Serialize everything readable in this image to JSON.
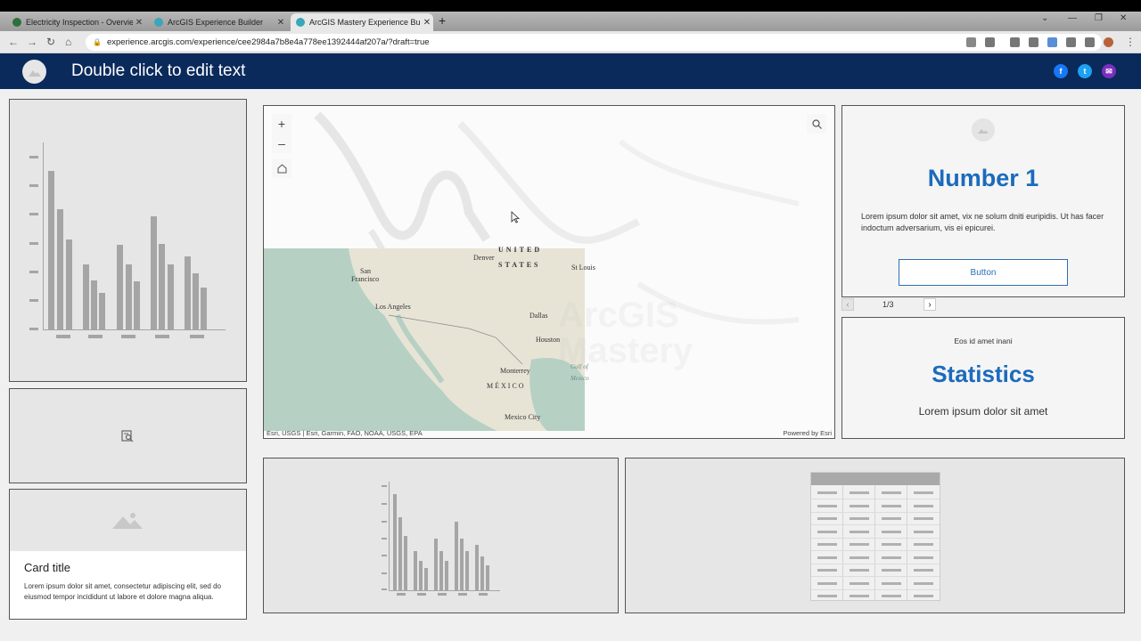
{
  "browser": {
    "tabs": [
      {
        "title": "Electricity Inspection - Overview",
        "active": false
      },
      {
        "title": "ArcGIS Experience Builder",
        "active": false
      },
      {
        "title": "ArcGIS Mastery Experience Builde",
        "active": true
      }
    ],
    "new_tab": "+",
    "url": "experience.arcgis.com/experience/cee2984a7b8e4a778ee1392444af207a/?draft=true"
  },
  "header": {
    "title": "Double click to edit text",
    "social": [
      {
        "name": "facebook",
        "glyph": "f",
        "color": "#1877f2"
      },
      {
        "name": "twitter",
        "glyph": "t",
        "color": "#1da1f2"
      },
      {
        "name": "email",
        "glyph": "✉",
        "color": "#7b2fbf"
      }
    ]
  },
  "map": {
    "zoom_in": "+",
    "zoom_out": "–",
    "labels": [
      "UNITED",
      "STATES",
      "Denver",
      "St Louis",
      "San",
      "Francisco",
      "Los Angeles",
      "Dallas",
      "Houston",
      "Monterrey",
      "MÉXICO",
      "Mexico City",
      "Gulf of",
      "Mexico"
    ],
    "watermark": [
      "ArcGIS",
      "Mastery"
    ],
    "attribution": "Esri, USGS | Esri, Garmin, FAO, NOAA, USGS, EPA",
    "powered_by": "Powered by Esri"
  },
  "number_card": {
    "heading": "Number 1",
    "body": "Lorem ipsum dolor sit amet, vix ne solum dniti euripidis. Ut has facer indoctum adversarium, vis ei epicurei.",
    "button": "Button",
    "pager": "1/3"
  },
  "stats_card": {
    "eyebrow": "Eos id amet inani",
    "heading": "Statistics",
    "body": "Lorem ipsum dolor sit amet"
  },
  "card": {
    "title": "Card title",
    "body": "Lorem ipsum dolor sit amet, consectetur adipiscing elit, sed do eiusmod tempor incididunt ut labore et dolore magna aliqua."
  }
}
